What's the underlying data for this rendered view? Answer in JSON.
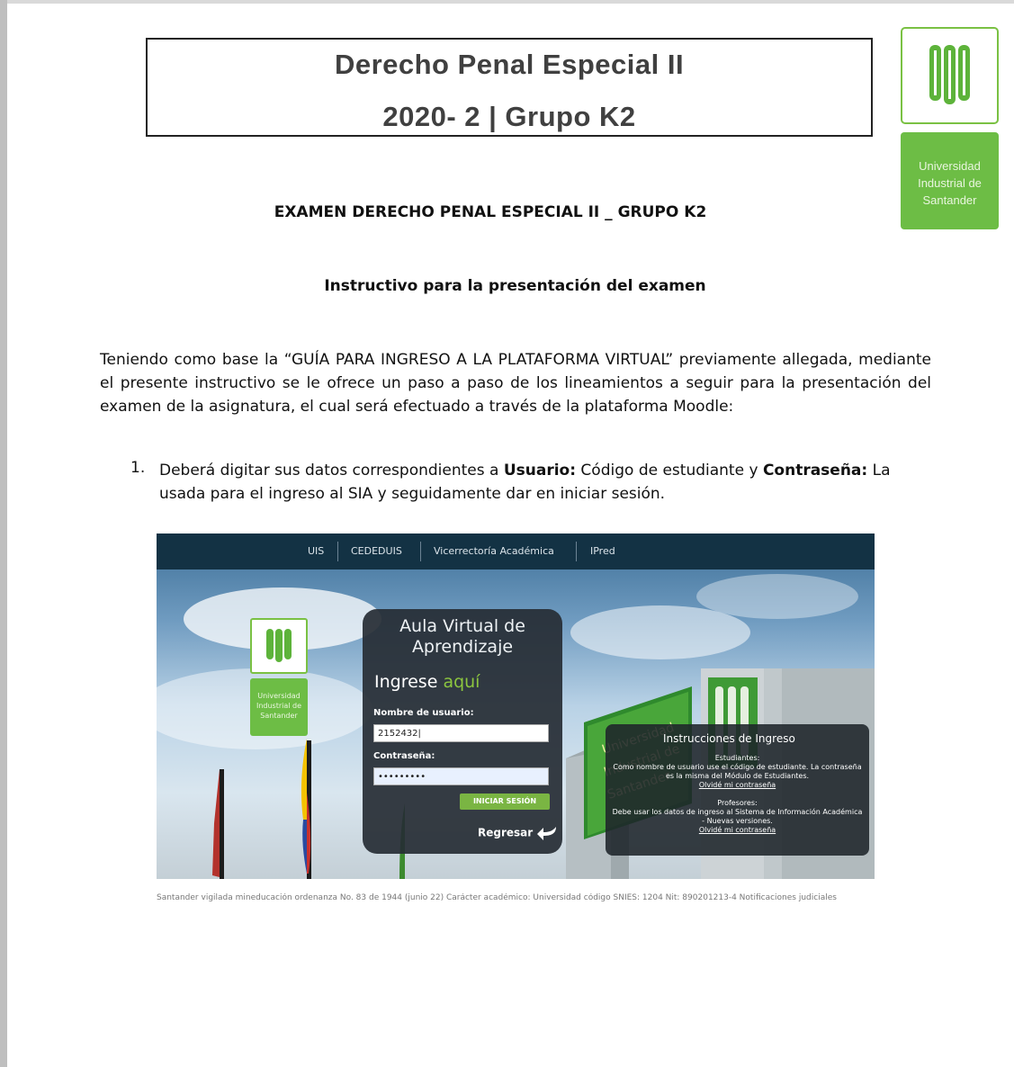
{
  "header": {
    "course_title": "Derecho Penal Especial II",
    "course_group": "2020- 2 | Grupo K2"
  },
  "logo": {
    "mark": "UIS",
    "line1": "Universidad",
    "line2": "Industrial de",
    "line3": "Santander",
    "brand_green": "#6dbd45"
  },
  "exam_title": "EXAMEN DERECHO PENAL ESPECIAL II _ GRUPO K2",
  "instructions_title": "Instructivo para la presentación del examen",
  "intro_paragraph": "Teniendo como base la “GUÍA PARA INGRESO A LA PLATAFORMA VIRTUAL” previamente allegada, mediante el presente instructivo se le ofrece un paso a paso de los lineamientos a seguir para la presentación del examen de la asignatura, el cual será efectuado a través de la plataforma Moodle:",
  "step1": {
    "number": "1.",
    "text_a": "Deberá digitar sus datos correspondientes a ",
    "bold_user": "Usuario:",
    "text_b": " Código de estudiante y ",
    "bold_pass": "Contraseña:",
    "text_c": " La usada para el ingreso al SIA y seguidamente dar en iniciar sesión."
  },
  "screenshot": {
    "nav": [
      "UIS",
      "CEDEDUIS",
      "Vicerrectoría Académica",
      "IPred"
    ],
    "nav_bg": "#133244",
    "panel_title_line1": "Aula Virtual de",
    "panel_title_line2": "Aprendizaje",
    "ingrese": "Ingrese",
    "aqui": "aquí",
    "username_label": "Nombre de usuario:",
    "username_value": "2152432|",
    "password_label": "Contraseña:",
    "password_value": "•••••••••",
    "login_button": "INICIAR SESIÓN",
    "back_link": "Regresar",
    "building_sign": "Universidad Industrial de Santander",
    "instructions_box": {
      "title": "Instrucciones de Ingreso",
      "students_heading": "Estudiantes:",
      "students_text": "Como nombre de usuario use el código de estudiante. La contraseña es la misma del Módulo de Estudiantes.",
      "students_link": "Olvidé mi contraseña",
      "teachers_heading": "Profesores:",
      "teachers_text": "Debe usar los datos de ingreso al Sistema de Información Académica - Nuevas versiones.",
      "teachers_link": "Olvidé mi contraseña"
    },
    "footer_text": "Santander vigilada mineducación ordenanza No. 83 de 1944 (junio 22) Carácter académico: Universidad código SNIES: 1204 Nit: 890201213-4 Notificaciones judiciales"
  }
}
